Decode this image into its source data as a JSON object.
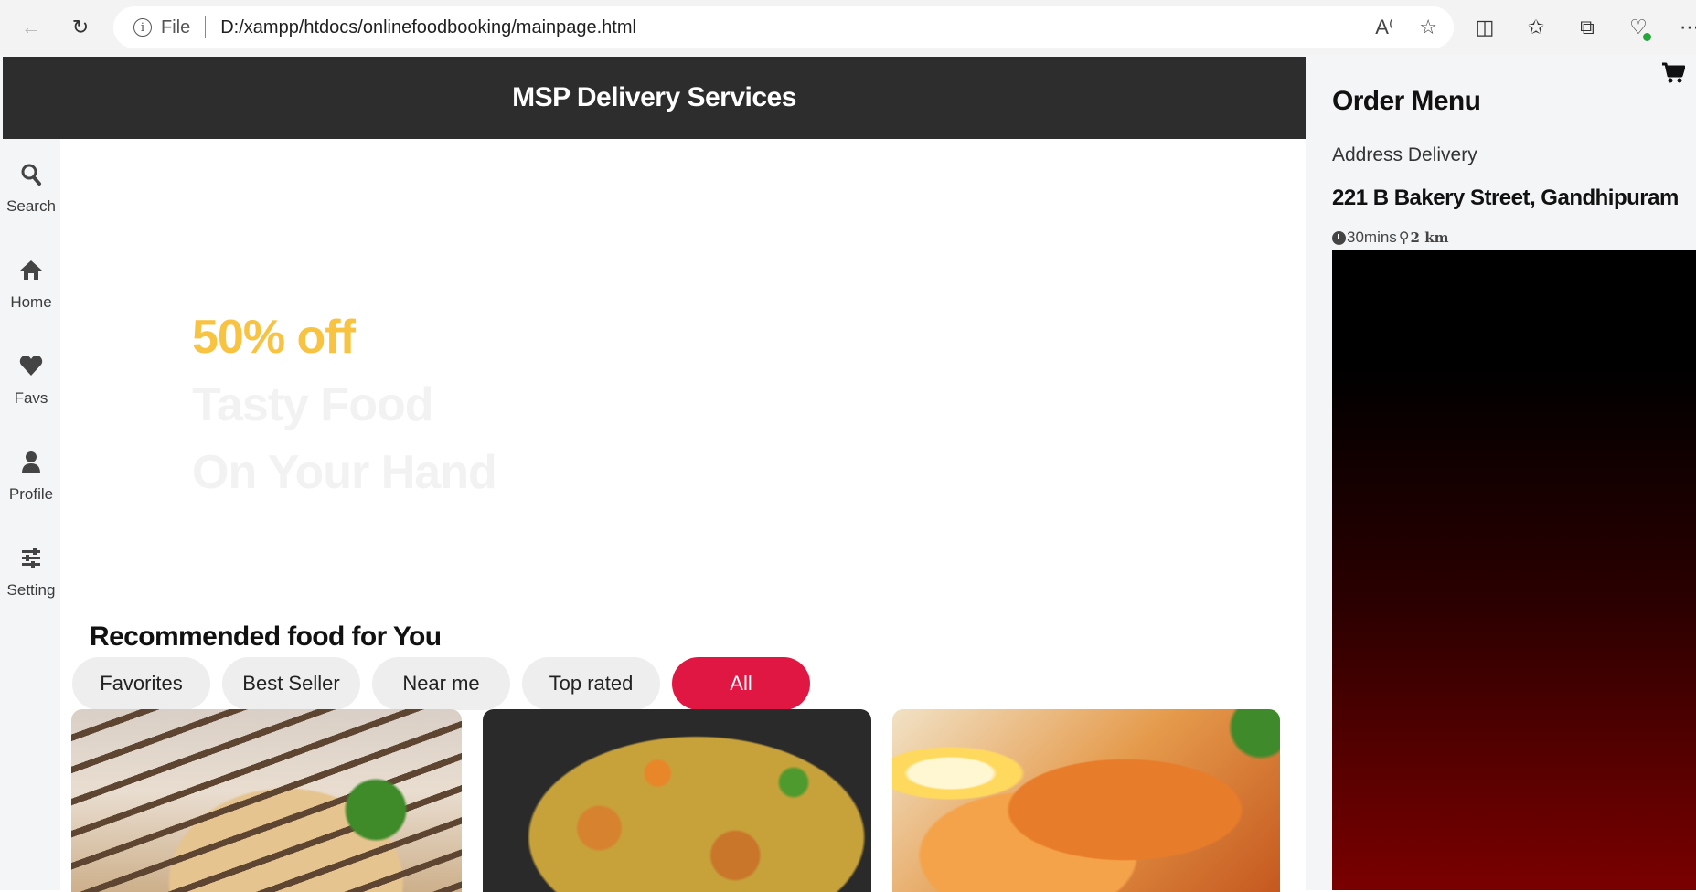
{
  "browser": {
    "file_label": "File",
    "url": "D:/xampp/htdocs/onlinefoodbooking/mainpage.html",
    "icons": {
      "back": "back-arrow-icon",
      "reload": "reload-icon",
      "info": "info-icon",
      "read_aloud": "read-aloud-icon",
      "favorite": "star-icon",
      "split_screen": "split-screen-icon",
      "favorites_bar": "favorites-icon",
      "collections": "collections-icon",
      "browser_essentials": "heart-pulse-icon",
      "more": "more-icon"
    }
  },
  "header": {
    "title": "MSP Delivery Services"
  },
  "sidebar": {
    "items": [
      {
        "label": "Search",
        "icon": "search-icon"
      },
      {
        "label": "Home",
        "icon": "home-icon"
      },
      {
        "label": "Favs",
        "icon": "heart-icon"
      },
      {
        "label": "Profile",
        "icon": "user-icon"
      },
      {
        "label": "Setting",
        "icon": "sliders-icon"
      }
    ]
  },
  "promo": {
    "line1": "50% off",
    "line2": "Tasty Food",
    "line3": "On Your Hand",
    "accent_color": "#f7c340"
  },
  "recommended": {
    "title": "Recommended food for You",
    "filters": [
      "Favorites",
      "Best Seller",
      "Near me",
      "Top rated",
      "All"
    ],
    "active_filter": "All",
    "active_color": "#e11743",
    "cards": [
      {
        "image": "grilled sandwich"
      },
      {
        "image": "shrimp fried rice"
      },
      {
        "image": "roasted shrimp platter"
      }
    ]
  },
  "order_menu": {
    "title": "Order Menu",
    "address_label": "Address Delivery",
    "address": "221 B Bakery Street, Gandhipuram",
    "time": "30mins",
    "distance": "2 km",
    "cart_icon": "cart-icon"
  }
}
